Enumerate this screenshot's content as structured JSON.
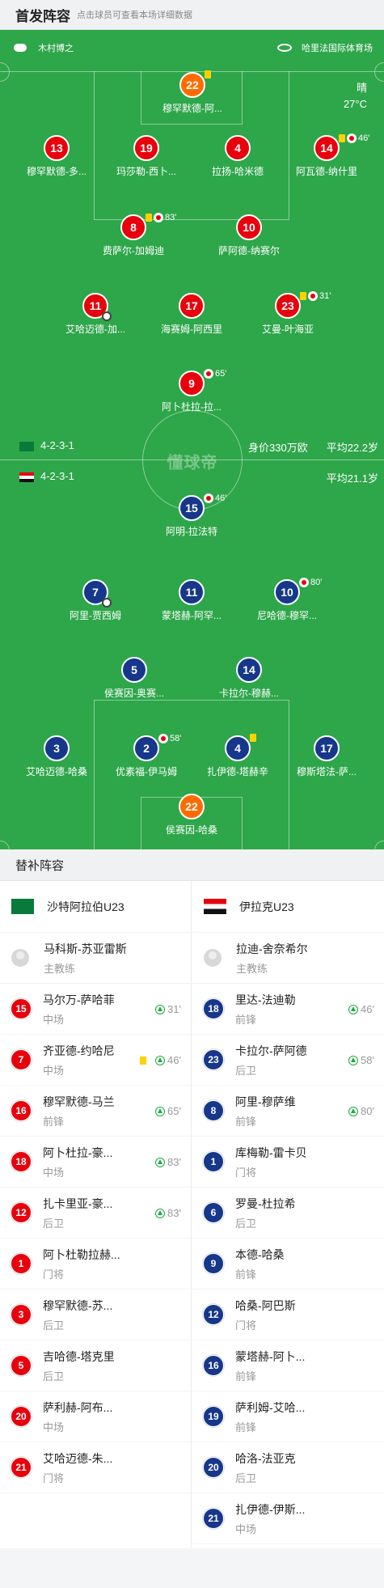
{
  "header": {
    "title": "首发阵容",
    "hint": "点击球员可查看本场详细数据"
  },
  "match": {
    "referee": "木村博之",
    "venue": "哈里法国际体育场",
    "weather": "晴",
    "temperature": "27°C",
    "watermark": "懂球帝"
  },
  "home": {
    "name": "沙特阿拉伯U23",
    "formation": "4-2-3-1",
    "value": "身价330万欧",
    "avg_age": "平均22.2岁",
    "flag_color": "#0a7a3b"
  },
  "away": {
    "name": "伊拉克U23",
    "formation": "4-2-3-1",
    "avg_age": "平均21.1岁",
    "flag_color": "#e8000d"
  },
  "home_players": [
    {
      "num": "22",
      "name": "穆罕默德-阿...",
      "events": "",
      "yc": true
    },
    {
      "num": "13",
      "name": "穆罕默德-多..."
    },
    {
      "num": "19",
      "name": "玛莎勒-西卜..."
    },
    {
      "num": "4",
      "name": "拉扬-哈米德"
    },
    {
      "num": "14",
      "name": "阿瓦德-纳什里",
      "events": "46'"
    },
    {
      "num": "8",
      "name": "费萨尔-加姆迪",
      "events": "83'"
    },
    {
      "num": "10",
      "name": "萨阿德-纳赛尔"
    },
    {
      "num": "11",
      "name": "艾哈迈德-加..."
    },
    {
      "num": "17",
      "name": "海赛姆-阿西里"
    },
    {
      "num": "23",
      "name": "艾曼-叶海亚",
      "events": "31'"
    },
    {
      "num": "9",
      "name": "阿卜杜拉-拉...",
      "events": "65'"
    }
  ],
  "away_players": [
    {
      "num": "15",
      "name": "阿明-拉法特",
      "events": "46'"
    },
    {
      "num": "7",
      "name": "阿里-贾西姆"
    },
    {
      "num": "11",
      "name": "蒙塔赫-阿罕..."
    },
    {
      "num": "10",
      "name": "尼哈德-穆罕...",
      "events": "80'"
    },
    {
      "num": "5",
      "name": "侯赛因-奥赛..."
    },
    {
      "num": "14",
      "name": "卡拉尔-穆赫..."
    },
    {
      "num": "3",
      "name": "艾哈迈德-哈桑"
    },
    {
      "num": "2",
      "name": "优素福-伊马姆",
      "events": "58'"
    },
    {
      "num": "4",
      "name": "扎伊德-塔赫辛"
    },
    {
      "num": "17",
      "name": "穆斯塔法-萨..."
    },
    {
      "num": "22",
      "name": "侯赛因-哈桑"
    }
  ],
  "subs_title": "替补阵容",
  "home_coach": {
    "name": "马科斯-苏亚雷斯",
    "role": "主教练"
  },
  "away_coach": {
    "name": "拉迪-舍奈希尔",
    "role": "主教练"
  },
  "home_subs": [
    {
      "num": "15",
      "name": "马尔万-萨哈菲",
      "pos": "中场",
      "tag": "31'"
    },
    {
      "num": "7",
      "name": "齐亚德-约哈尼",
      "pos": "中场",
      "tag": "46'",
      "yc": true
    },
    {
      "num": "16",
      "name": "穆罕默德-马兰",
      "pos": "前锋",
      "tag": "65'"
    },
    {
      "num": "18",
      "name": "阿卜杜拉-豪...",
      "pos": "中场",
      "tag": "83'"
    },
    {
      "num": "12",
      "name": "扎卡里亚-豪...",
      "pos": "后卫",
      "tag": "83'"
    },
    {
      "num": "1",
      "name": "阿卜杜勒拉赫...",
      "pos": "门将",
      "tag": ""
    },
    {
      "num": "3",
      "name": "穆罕默德-苏...",
      "pos": "后卫",
      "tag": ""
    },
    {
      "num": "5",
      "name": "吉哈德-塔克里",
      "pos": "后卫",
      "tag": ""
    },
    {
      "num": "20",
      "name": "萨利赫-阿布...",
      "pos": "中场",
      "tag": ""
    },
    {
      "num": "21",
      "name": "艾哈迈德-朱...",
      "pos": "门将",
      "tag": ""
    }
  ],
  "away_subs": [
    {
      "num": "18",
      "name": "里达-法迪勒",
      "pos": "前锋",
      "tag": "46'"
    },
    {
      "num": "23",
      "name": "卡拉尔-萨阿德",
      "pos": "后卫",
      "tag": "58'"
    },
    {
      "num": "8",
      "name": "阿里-穆萨维",
      "pos": "前锋",
      "tag": "80'"
    },
    {
      "num": "1",
      "name": "库梅勒-雷卡贝",
      "pos": "门将",
      "tag": ""
    },
    {
      "num": "6",
      "name": "罗曼-杜拉希",
      "pos": "后卫",
      "tag": ""
    },
    {
      "num": "9",
      "name": "本德-哈桑",
      "pos": "前锋",
      "tag": ""
    },
    {
      "num": "12",
      "name": "哈桑-阿巴斯",
      "pos": "门将",
      "tag": ""
    },
    {
      "num": "16",
      "name": "蒙塔赫-阿卜...",
      "pos": "前锋",
      "tag": ""
    },
    {
      "num": "19",
      "name": "萨利姆-艾哈...",
      "pos": "前锋",
      "tag": ""
    },
    {
      "num": "20",
      "name": "哈洛-法亚克",
      "pos": "后卫",
      "tag": ""
    },
    {
      "num": "21",
      "name": "扎伊德-伊斯...",
      "pos": "中场",
      "tag": ""
    }
  ]
}
